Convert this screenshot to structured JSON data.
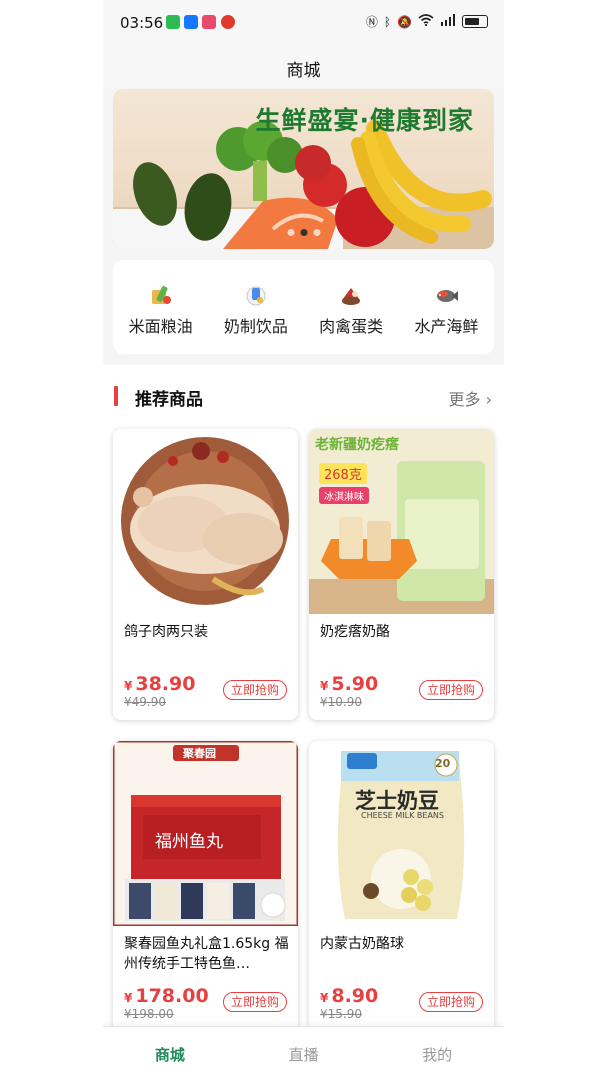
{
  "status": {
    "time": "03:56",
    "icons": [
      "wechat-icon",
      "alipay-icon",
      "app-icon",
      "app-icon-2",
      "nfc-icon",
      "bluetooth-icon",
      "mute-icon",
      "wifi-icon",
      "signal-icon",
      "battery-icon"
    ]
  },
  "nav": {
    "title": "商城"
  },
  "banner": {
    "text": "生鲜盛宴·健康到家",
    "dot_count": 3,
    "active_dot": 1
  },
  "categories": [
    {
      "label": "米面粮油",
      "icon": "grain-icon"
    },
    {
      "label": "奶制饮品",
      "icon": "milk-icon"
    },
    {
      "label": "肉禽蛋类",
      "icon": "meat-icon"
    },
    {
      "label": "水产海鲜",
      "icon": "fish-icon"
    }
  ],
  "section": {
    "title": "推荐商品",
    "more": "更多"
  },
  "products": [
    {
      "name": "鸽子肉两只装",
      "price": "38.90",
      "old_price": "49.90",
      "buy": "立即抢购"
    },
    {
      "name": "奶疙瘩奶酪",
      "price": "5.90",
      "old_price": "10.90",
      "buy": "立即抢购",
      "img_title": "老新疆奶疙瘩",
      "img_badge": "268克",
      "img_sub": "冰淇淋味"
    },
    {
      "name": "聚春园鱼丸礼盒1.65kg 福州传统手工特色鱼…",
      "price": "178.00",
      "old_price": "198.00",
      "buy": "立即抢购",
      "img_brand": "聚春园",
      "img_title": "福州鱼丸"
    },
    {
      "name": "内蒙古奶酪球",
      "price": "8.90",
      "old_price": "15.90",
      "buy": "立即抢购",
      "img_title": "芝士奶豆",
      "img_sub": "CHEESE MILK BEANS",
      "img_badge": "20"
    }
  ],
  "currency": "¥",
  "tabs": [
    {
      "label": "商城",
      "active": true
    },
    {
      "label": "直播",
      "active": false
    },
    {
      "label": "我的",
      "active": false
    }
  ],
  "colors": {
    "accent": "#e84040",
    "tab_active": "#1f8a5a",
    "banner_text": "#1d7a2e"
  }
}
